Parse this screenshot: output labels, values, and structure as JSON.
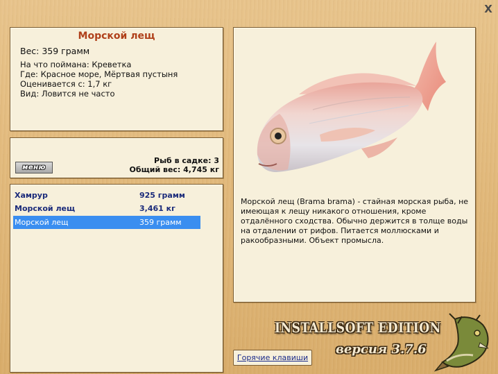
{
  "window": {
    "close_label": "X"
  },
  "info": {
    "title": "Морской лещ",
    "weight": "Вес: 359 грамм",
    "bait": "На что поймана: Креветка",
    "location": "Где: Красное море, Мёртвая пустыня",
    "value": "Оценивается с: 1,7 кг",
    "rarity": "Вид: Ловится не часто"
  },
  "cage": {
    "menu_label": "меню",
    "fish_count": "Рыб в садке: 3",
    "total_weight": "Общий вес: 4,745 кг"
  },
  "catch_list": [
    {
      "name": "Хамрур",
      "weight": "925 грамм"
    },
    {
      "name": "Морской лещ",
      "weight": "3,461 кг"
    },
    {
      "name": "Морской лещ",
      "weight": "359 грамм"
    }
  ],
  "detail": {
    "image_icon": "sea-bream-image",
    "description": "Морской лещ (Brama brama) - стайная морская рыба, не имеющая к лещу никакого отношения, кроме отдалённого сходства. Обычно держится в толще воды на отдалении от рифов. Питается моллюсками и ракообразными. Объект промысла."
  },
  "footer": {
    "brand": "INSTALLSOFT EDITION",
    "version": "версия 3.7.6",
    "hotkeys_label": "Горячие клавиши"
  },
  "colors": {
    "title": "#b0401a",
    "list_bold": "#1a2a7a",
    "selection": "#3a8ef0",
    "panel": "#f7f0db"
  }
}
